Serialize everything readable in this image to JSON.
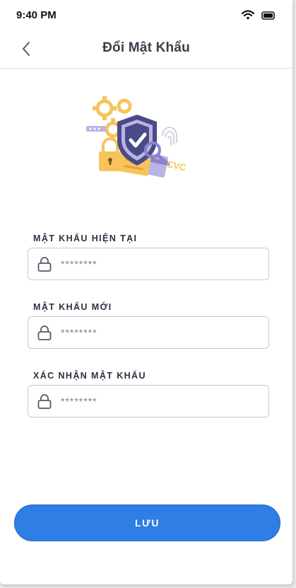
{
  "status_bar": {
    "time": "9:40 PM",
    "wifi_icon": "wifi-icon",
    "battery_icon": "battery-icon"
  },
  "header": {
    "title": "Đổi Mật Khẩu",
    "back_icon": "chevron-left-icon"
  },
  "illustration": {
    "icon": "security-shield-illustration",
    "card_code_text": "CVC"
  },
  "fields": [
    {
      "label": "MẬT KHẨU HIỆN TẠI",
      "placeholder": "********",
      "icon": "lock-icon"
    },
    {
      "label": "MẬT KHẨU MỚI",
      "placeholder": "********",
      "icon": "lock-icon"
    },
    {
      "label": "XÁC NHẬN MẬT KHẨU",
      "placeholder": "********",
      "icon": "lock-icon"
    }
  ],
  "save_button": {
    "label": "LƯU"
  },
  "colors": {
    "primary": "#2f7ee6",
    "shield": "#4a4a86",
    "accent_yellow": "#f7c45c",
    "accent_purple": "#b9b3e6"
  }
}
